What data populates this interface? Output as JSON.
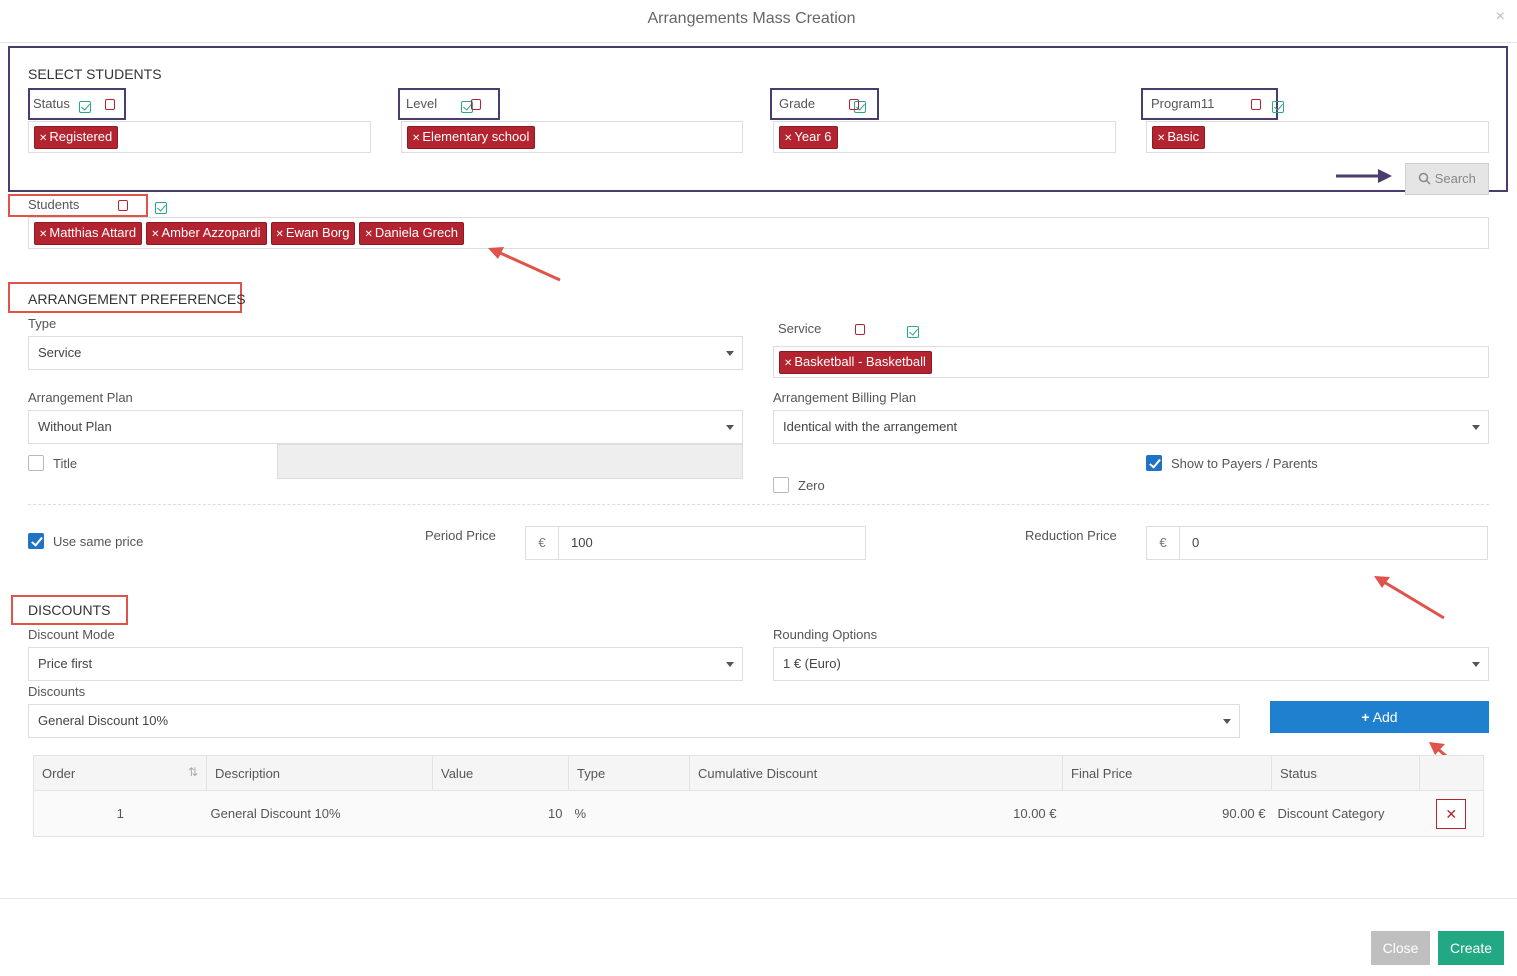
{
  "modal": {
    "title": "Arrangements Mass Creation",
    "close_symbol": "×"
  },
  "select_students": {
    "title": "SELECT STUDENTS",
    "filters": [
      {
        "label": "Status",
        "tags": [
          "Registered"
        ]
      },
      {
        "label": "Level",
        "tags": [
          "Elementary school"
        ]
      },
      {
        "label": "Grade",
        "tags": [
          "Year 6"
        ]
      },
      {
        "label": "Program11",
        "tags": [
          "Basic"
        ]
      }
    ],
    "search_button": "Search"
  },
  "students": {
    "label": "Students",
    "tags": [
      "Matthias Attard",
      "Amber Azzopardi",
      "Ewan Borg",
      "Daniela Grech"
    ]
  },
  "preferences": {
    "title": "ARRANGEMENT PREFERENCES",
    "type_label": "Type",
    "type_value": "Service",
    "service_label": "Service",
    "service_tags": [
      "Basketball - Basketball"
    ],
    "plan_label": "Arrangement Plan",
    "plan_value": "Without Plan",
    "billing_label": "Arrangement Billing Plan",
    "billing_value": "Identical with the arrangement",
    "title_checkbox_label": "Title",
    "show_payers_label": "Show to Payers / Parents",
    "zero_label": "Zero",
    "use_same_price_label": "Use same price",
    "period_price_label": "Period Price",
    "period_price_currency": "€",
    "period_price_value": "100",
    "reduction_price_label": "Reduction Price",
    "reduction_price_currency": "€",
    "reduction_price_value": "0"
  },
  "discounts": {
    "title": "DISCOUNTS",
    "mode_label": "Discount Mode",
    "mode_value": "Price first",
    "rounding_label": "Rounding Options",
    "rounding_value": "1 € (Euro)",
    "discounts_label": "Discounts",
    "discounts_value": "General Discount 10%",
    "add_button": "Add",
    "columns": [
      "Order",
      "Description",
      "Value",
      "Type",
      "Cumulative Discount",
      "Final Price",
      "Status"
    ],
    "rows": [
      {
        "order": "1",
        "description": "General Discount 10%",
        "value": "10",
        "type": "%",
        "cumulative": "10.00 €",
        "final": "90.00 €",
        "status": "Discount Category"
      }
    ]
  },
  "footer": {
    "close": "Close",
    "create": "Create"
  },
  "colors": {
    "tag": "#b32430",
    "add": "#1f80cf",
    "create": "#22a883",
    "annotation_purple": "#4b3c6e",
    "annotation_red": "#e0534a"
  }
}
